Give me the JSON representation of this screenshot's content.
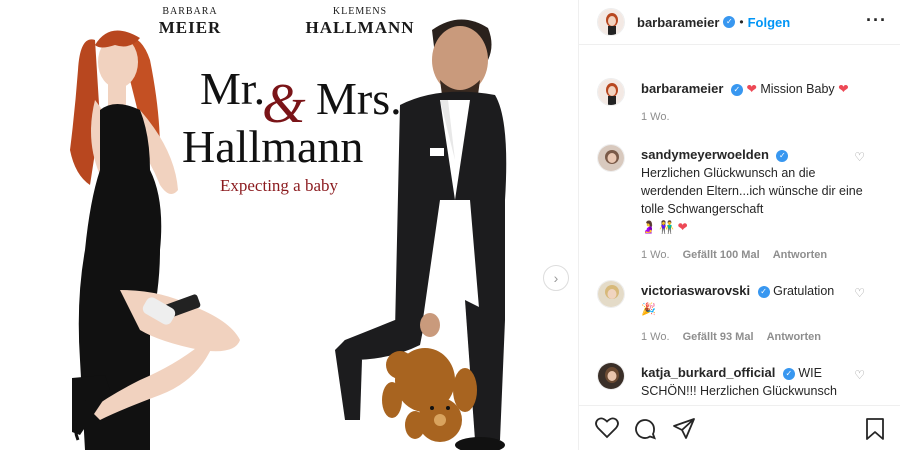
{
  "poster": {
    "left_credit_first": "BARBARA",
    "left_credit_last": "MEIER",
    "right_credit_first": "KLEMENS",
    "right_credit_last": "HALLMANN",
    "title_mr": "Mr.",
    "title_amp": "&",
    "title_mrs": "Mrs.",
    "title_name": "Hallmann",
    "tagline": "Expecting a baby"
  },
  "header": {
    "handle": "barbarameier",
    "separator": "•",
    "follow_label": "Folgen",
    "more_icon": "more-horizontal-icon"
  },
  "caption": {
    "handle": "barbarameier",
    "text": "Mission Baby",
    "time": "1 Wo."
  },
  "comments": [
    {
      "handle": "sandymeyerwoelden",
      "text": "Herzlichen Glückwunsch an die werdenden Eltern...ich wünsche dir eine tolle Schwangerschaft",
      "time": "1 Wo.",
      "likes": "Gefällt 100 Mal",
      "reply": "Antworten"
    },
    {
      "handle": "victoriaswarovski",
      "text": "Gratulation",
      "time": "1 Wo.",
      "likes": "Gefällt 93 Mal",
      "reply": "Antworten"
    },
    {
      "handle": "katja_burkard_official",
      "text": "WIE SCHÖN!!! Herzlichen Glückwunsch"
    }
  ],
  "colors": {
    "accent_blue": "#0095f6",
    "verified_blue": "#3897f0",
    "heart_red": "#ed4956",
    "title_red": "#8b1a1e"
  },
  "icons": [
    "heart-icon",
    "comment-icon",
    "share-icon",
    "bookmark-icon",
    "chevron-right-icon",
    "verified-icon"
  ]
}
